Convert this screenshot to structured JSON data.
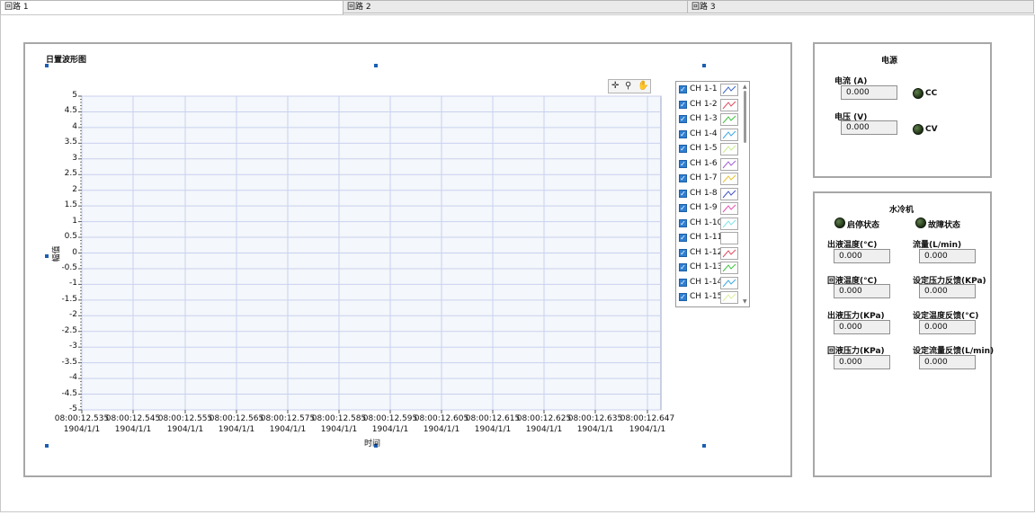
{
  "tabs": [
    {
      "label": "回路 1",
      "active": true
    },
    {
      "label": "回路 2",
      "active": false
    },
    {
      "label": "回路 3",
      "active": false
    }
  ],
  "waveform": {
    "title": "日置波形图",
    "ylabel": "幅值",
    "xlabel": "时间"
  },
  "chart_data": {
    "type": "line",
    "title": "日置波形图",
    "xlabel": "时间",
    "ylabel": "幅值",
    "ylim": [
      -5,
      5
    ],
    "y_ticks": [
      "5",
      "4.5",
      "4",
      "3.5",
      "3",
      "2.5",
      "2",
      "1.5",
      "1",
      "0.5",
      "0",
      "-0.5",
      "-1",
      "-1.5",
      "-2",
      "-2.5",
      "-3",
      "-3.5",
      "-4",
      "-4.5",
      "-5"
    ],
    "x_ticks": [
      {
        "time": "08:00:12.535",
        "date": "1904/1/1"
      },
      {
        "time": "08:00:12.545",
        "date": "1904/1/1"
      },
      {
        "time": "08:00:12.555",
        "date": "1904/1/1"
      },
      {
        "time": "08:00:12.565",
        "date": "1904/1/1"
      },
      {
        "time": "08:00:12.575",
        "date": "1904/1/1"
      },
      {
        "time": "08:00:12.585",
        "date": "1904/1/1"
      },
      {
        "time": "08:00:12.595",
        "date": "1904/1/1"
      },
      {
        "time": "08:00:12.605",
        "date": "1904/1/1"
      },
      {
        "time": "08:00:12.615",
        "date": "1904/1/1"
      },
      {
        "time": "08:00:12.625",
        "date": "1904/1/1"
      },
      {
        "time": "08:00:12.635",
        "date": "1904/1/1"
      },
      {
        "time": "08:00:12.647",
        "date": "1904/1/1"
      }
    ],
    "grid": true,
    "series": [
      {
        "name": "CH 1-1",
        "color": "#3b63c9",
        "checked": true,
        "values": []
      },
      {
        "name": "CH 1-2",
        "color": "#e0485c",
        "checked": true,
        "values": []
      },
      {
        "name": "CH 1-3",
        "color": "#3ec23e",
        "checked": true,
        "values": []
      },
      {
        "name": "CH 1-4",
        "color": "#39a7e4",
        "checked": true,
        "values": []
      },
      {
        "name": "CH 1-5",
        "color": "#c6ec8a",
        "checked": true,
        "values": []
      },
      {
        "name": "CH 1-6",
        "color": "#a05cd6",
        "checked": true,
        "values": []
      },
      {
        "name": "CH 1-7",
        "color": "#e8c12e",
        "checked": true,
        "values": []
      },
      {
        "name": "CH 1-8",
        "color": "#3c4fc4",
        "checked": true,
        "values": []
      },
      {
        "name": "CH 1-9",
        "color": "#e54fb0",
        "checked": true,
        "values": []
      },
      {
        "name": "CH 1-10",
        "color": "#7fe3ea",
        "checked": true,
        "values": []
      },
      {
        "name": "CH 1-11",
        "color": "#ffffff",
        "checked": true,
        "values": []
      },
      {
        "name": "CH 1-12",
        "color": "#e0485c",
        "checked": true,
        "values": []
      },
      {
        "name": "CH 1-13",
        "color": "#3ec23e",
        "checked": true,
        "values": []
      },
      {
        "name": "CH 1-14",
        "color": "#39a7e4",
        "checked": true,
        "values": []
      },
      {
        "name": "CH 1-15",
        "color": "#dbee9a",
        "checked": true,
        "values": []
      }
    ]
  },
  "power": {
    "title": "电源",
    "current_label": "电流 (A)",
    "current_value": "0.000",
    "voltage_label": "电压 (V)",
    "voltage_value": "0.000",
    "cc_label": "CC",
    "cv_label": "CV"
  },
  "chiller": {
    "title": "水冷机",
    "run_status_label": "启停状态",
    "fault_status_label": "故障状态",
    "fields": [
      {
        "label": "出液温度(°C)",
        "value": "0.000"
      },
      {
        "label": "流量(L/min)",
        "value": "0.000"
      },
      {
        "label": "回液温度(°C)",
        "value": "0.000"
      },
      {
        "label": "设定压力反馈(KPa)",
        "value": "0.000"
      },
      {
        "label": "出液压力(KPa)",
        "value": "0.000"
      },
      {
        "label": "设定温度反馈(°C)",
        "value": "0.000"
      },
      {
        "label": "回液压力(KPa)",
        "value": "0.000"
      },
      {
        "label": "设定流量反馈(L/min)",
        "value": "0.000"
      }
    ]
  },
  "colors": {
    "plot_bg": "#f4f7fb",
    "grid": "#c5cdee",
    "selection": "#1a5fb4",
    "panel_border": "#a7a7a7"
  }
}
